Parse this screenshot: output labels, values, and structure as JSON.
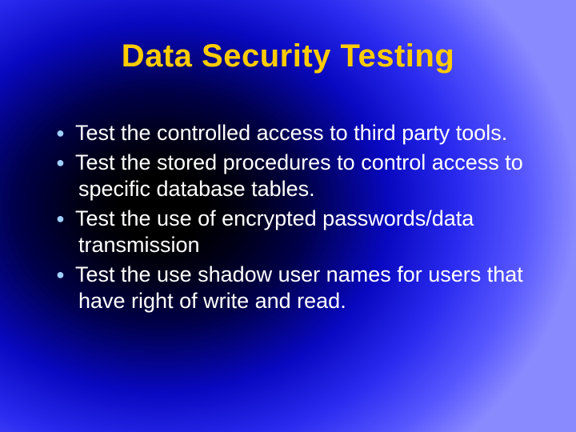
{
  "title": "Data Security Testing",
  "bullets": [
    "Test the controlled access to third party tools.",
    "Test the stored procedures to control access to specific database tables.",
    "Test the use of encrypted passwords/data transmission",
    "Test the use shadow user names for users that have right of write and read."
  ],
  "colors": {
    "title": "#ffcc00",
    "text": "#ffffff",
    "bullet": "#9ecfff"
  }
}
